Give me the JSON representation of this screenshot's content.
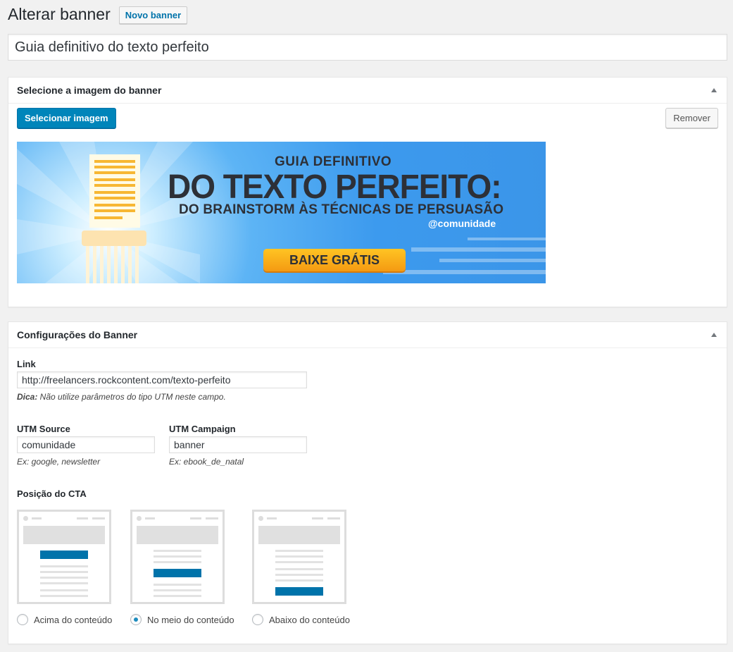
{
  "header": {
    "title": "Alterar banner",
    "new_button": "Novo banner"
  },
  "post_title": "Guia definitivo do texto perfeito",
  "image_box": {
    "title": "Selecione a imagem do banner",
    "select_button": "Selecionar imagem",
    "remove_button": "Remover",
    "banner": {
      "line1": "GUIA DEFINITIVO",
      "line2": "DO TEXTO PERFEITO:",
      "line3": "DO BRAINSTORM ÀS TÉCNICAS DE PERSUASÃO",
      "brand": "@comunidade",
      "cta": "BAIXE GRÁTIS"
    }
  },
  "settings_box": {
    "title": "Configurações do Banner",
    "link_label": "Link",
    "link_value": "http://freelancers.rockcontent.com/texto-perfeito",
    "link_hint_bold": "Dica:",
    "link_hint": " Não utilize parâmetros do tipo UTM neste campo.",
    "utm_source_label": "UTM Source",
    "utm_source_value": "comunidade",
    "utm_source_hint": "Ex: google, newsletter",
    "utm_campaign_label": "UTM Campaign",
    "utm_campaign_value": "banner",
    "utm_campaign_hint": "Ex: ebook_de_natal",
    "cta_position_label": "Posição do CTA",
    "cta_options": [
      {
        "label": "Acima do conteúdo",
        "checked": false
      },
      {
        "label": "No meio do conteúdo",
        "checked": true
      },
      {
        "label": "Abaixo do conteúdo",
        "checked": false
      }
    ]
  },
  "colors": {
    "primary": "#0085ba",
    "cta_blue": "#0073aa",
    "background": "#f1f1f1"
  }
}
